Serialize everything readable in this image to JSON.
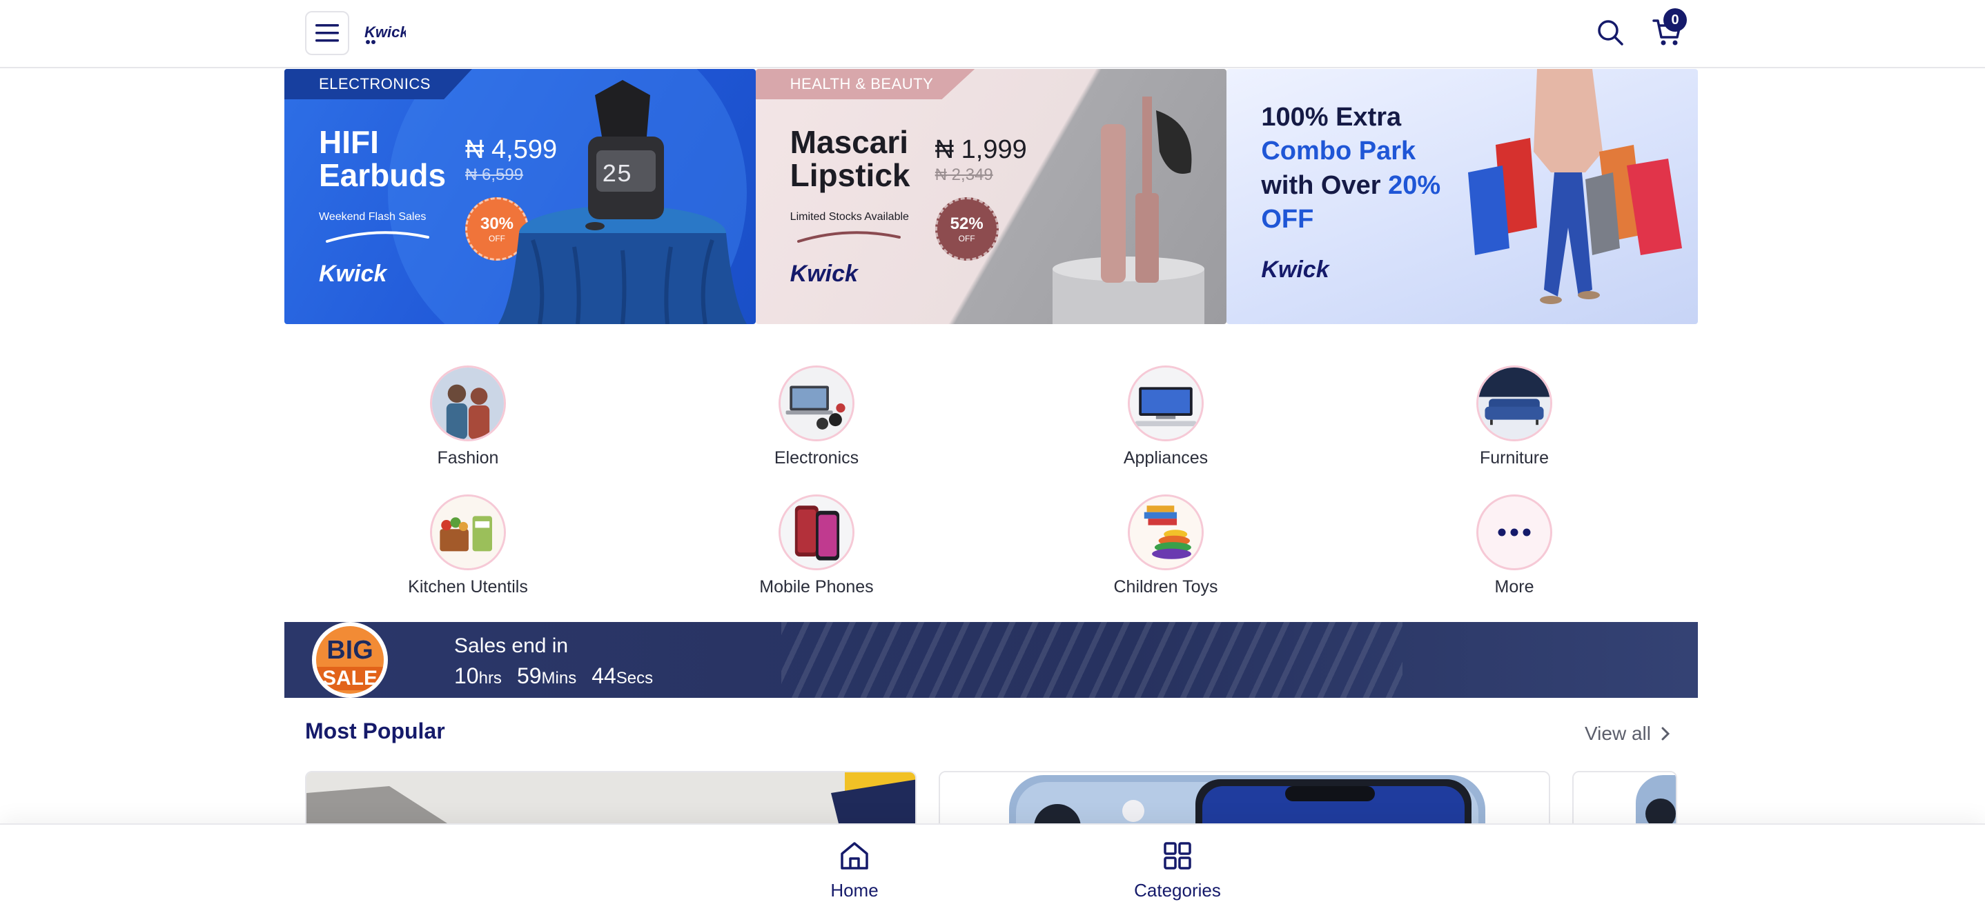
{
  "header": {
    "logo_text": "Kwick",
    "cart_count": "0",
    "icons": {
      "menu": "menu-icon",
      "search": "search-icon",
      "cart": "cart-icon"
    }
  },
  "banners": [
    {
      "tag": "ELECTRONICS",
      "title_line1": "HIFI",
      "title_line2": "Earbuds",
      "price": "₦ 4,599",
      "old_price": "₦ 6,599",
      "subtitle": "Weekend Flash Sales",
      "discount": "30%",
      "discount_off": "OFF",
      "logo": "Kwick"
    },
    {
      "tag": "HEALTH & BEAUTY",
      "title_line1": "Mascari",
      "title_line2": "Lipstick",
      "price": "₦ 1,999",
      "old_price": "₦ 2,349",
      "subtitle": "Limited Stocks Available",
      "discount": "52%",
      "discount_off": "OFF",
      "logo": "Kwick"
    },
    {
      "line1": "100% Extra",
      "line2": "Combo Park",
      "line3a": "with Over ",
      "line3b": "20%",
      "line4": "OFF",
      "logo": "Kwick"
    }
  ],
  "categories": [
    {
      "label": "Fashion"
    },
    {
      "label": "Electronics"
    },
    {
      "label": "Appliances"
    },
    {
      "label": "Furniture"
    },
    {
      "label": "Kitchen Utentils"
    },
    {
      "label": "Mobile Phones"
    },
    {
      "label": "Children Toys"
    },
    {
      "label": "More"
    }
  ],
  "sale": {
    "badge_big": "BIG",
    "badge_sale": "SALE",
    "label": "Sales end in",
    "hours": "10",
    "hours_unit": "hrs",
    "mins": "59",
    "mins_unit": "Mins",
    "secs": "44",
    "secs_unit": "Secs"
  },
  "most_popular": {
    "title": "Most Popular",
    "view_all": "View all"
  },
  "bottom_nav": {
    "home": "Home",
    "categories": "Categories"
  },
  "colors": {
    "brand_navy": "#151a6a",
    "accent_blue": "#1f56d6",
    "accent_orange": "#f28b35",
    "category_ring": "#f6c9d6"
  }
}
